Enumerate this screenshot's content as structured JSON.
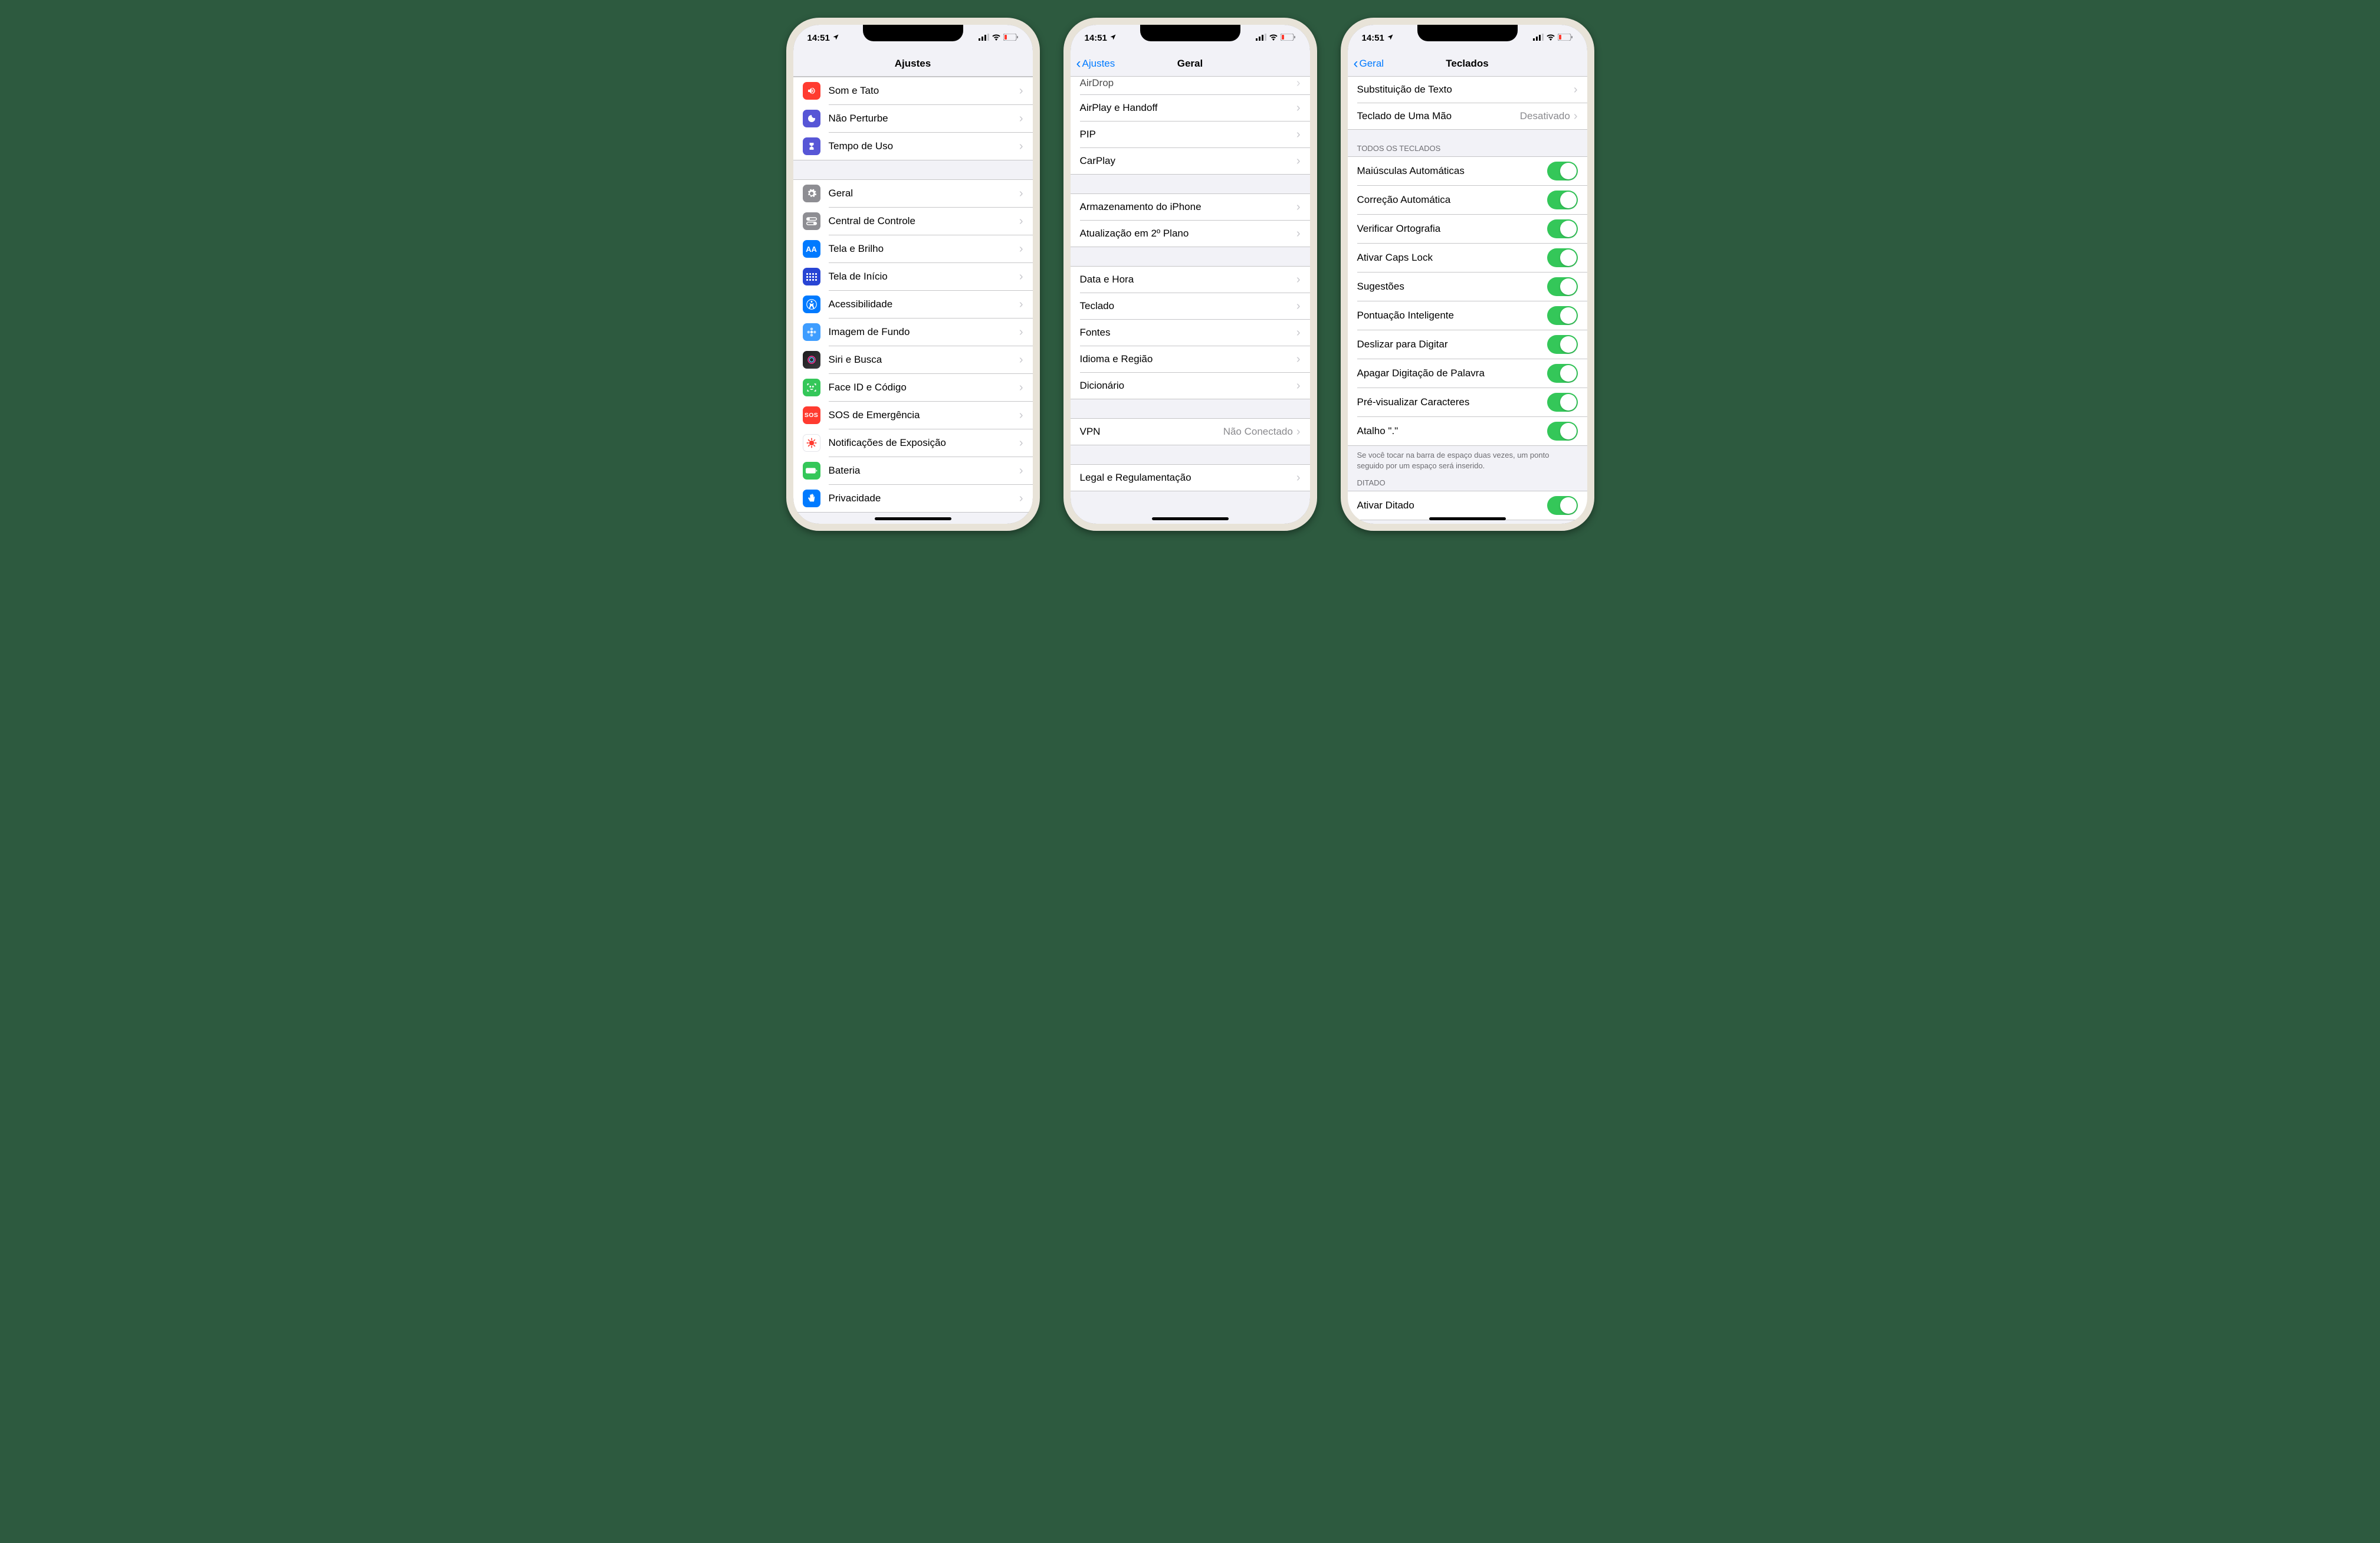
{
  "status": {
    "time": "14:51"
  },
  "phones": {
    "p1": {
      "title": "Ajustes",
      "back": null,
      "items_a": [
        {
          "label": "Som e Tato",
          "icon": "volume-icon",
          "color": "ic-red"
        },
        {
          "label": "Não Perturbe",
          "icon": "moon-icon",
          "color": "ic-purple"
        },
        {
          "label": "Tempo de Uso",
          "icon": "hourglass-icon",
          "color": "ic-hourglass"
        }
      ],
      "items_b": [
        {
          "label": "Geral",
          "icon": "gear-icon",
          "color": "ic-gray"
        },
        {
          "label": "Central de Controle",
          "icon": "switches-icon",
          "color": "ic-gray"
        },
        {
          "label": "Tela e Brilho",
          "icon": "textsize-icon",
          "color": "ic-bluedark"
        },
        {
          "label": "Tela de Início",
          "icon": "grid-icon",
          "color": "ic-bluedark"
        },
        {
          "label": "Acessibilidade",
          "icon": "accessibility-icon",
          "color": "ic-bluedark"
        },
        {
          "label": "Imagem de Fundo",
          "icon": "flower-icon",
          "color": "ic-cyan"
        },
        {
          "label": "Siri e Busca",
          "icon": "siri-icon",
          "color": "ic-siri"
        },
        {
          "label": "Face ID e Código",
          "icon": "faceid-icon",
          "color": "ic-green"
        },
        {
          "label": "SOS de Emergência",
          "icon": "sos-icon",
          "color": "ic-sos"
        },
        {
          "label": "Notificações de Exposição",
          "icon": "covid-icon",
          "color": "ic-covid"
        },
        {
          "label": "Bateria",
          "icon": "battery-icon",
          "color": "ic-green"
        },
        {
          "label": "Privacidade",
          "icon": "hand-icon",
          "color": "ic-bluedark"
        }
      ]
    },
    "p2": {
      "title": "Geral",
      "back": "Ajustes",
      "g1": [
        {
          "label": "AirDrop"
        },
        {
          "label": "AirPlay e Handoff"
        },
        {
          "label": "PIP"
        },
        {
          "label": "CarPlay"
        }
      ],
      "g2": [
        {
          "label": "Armazenamento do iPhone"
        },
        {
          "label": "Atualização em 2º Plano"
        }
      ],
      "g3": [
        {
          "label": "Data e Hora"
        },
        {
          "label": "Teclado"
        },
        {
          "label": "Fontes"
        },
        {
          "label": "Idioma e Região"
        },
        {
          "label": "Dicionário"
        }
      ],
      "g4": [
        {
          "label": "VPN",
          "detail": "Não Conectado"
        }
      ],
      "g5": [
        {
          "label": "Legal e Regulamentação"
        }
      ]
    },
    "p3": {
      "title": "Teclados",
      "back": "Geral",
      "g0": [
        {
          "label": "Substituição de Texto"
        },
        {
          "label": "Teclado de Uma Mão",
          "detail": "Desativado"
        }
      ],
      "headerAll": "Todos os Teclados",
      "toggles": [
        {
          "label": "Maiúsculas Automáticas",
          "on": true
        },
        {
          "label": "Correção Automática",
          "on": true
        },
        {
          "label": "Verificar Ortografia",
          "on": true
        },
        {
          "label": "Ativar Caps Lock",
          "on": true
        },
        {
          "label": "Sugestões",
          "on": true
        },
        {
          "label": "Pontuação Inteligente",
          "on": true
        },
        {
          "label": "Deslizar para Digitar",
          "on": true
        },
        {
          "label": "Apagar Digitação de Palavra",
          "on": true
        },
        {
          "label": "Pré-visualizar Caracteres",
          "on": true
        },
        {
          "label": "Atalho \".\"",
          "on": true
        }
      ],
      "footer": "Se você tocar na barra de espaço duas vezes, um ponto seguido por um espaço será inserido.",
      "headerDitado": "Ditado",
      "ditado": {
        "label": "Ativar Ditado",
        "on": true
      }
    }
  }
}
